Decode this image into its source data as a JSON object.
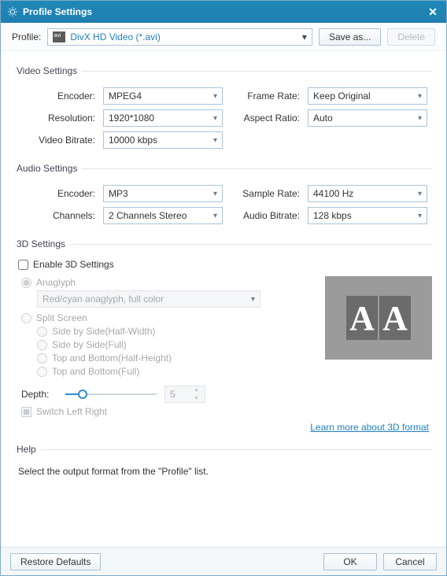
{
  "window": {
    "title": "Profile Settings"
  },
  "profile": {
    "label": "Profile:",
    "value": "DivX HD Video (*.avi)",
    "save_as": "Save as...",
    "delete": "Delete"
  },
  "video": {
    "legend": "Video Settings",
    "encoder_label": "Encoder:",
    "encoder": "MPEG4",
    "framerate_label": "Frame Rate:",
    "framerate": "Keep Original",
    "resolution_label": "Resolution:",
    "resolution": "1920*1080",
    "aspect_label": "Aspect Ratio:",
    "aspect": "Auto",
    "bitrate_label": "Video Bitrate:",
    "bitrate": "10000 kbps"
  },
  "audio": {
    "legend": "Audio Settings",
    "encoder_label": "Encoder:",
    "encoder": "MP3",
    "samplerate_label": "Sample Rate:",
    "samplerate": "44100 Hz",
    "channels_label": "Channels:",
    "channels": "2 Channels Stereo",
    "bitrate_label": "Audio Bitrate:",
    "bitrate": "128 kbps"
  },
  "threeD": {
    "legend": "3D Settings",
    "enable_label": "Enable 3D Settings",
    "anaglyph_label": "Anaglyph",
    "anaglyph_value": "Red/cyan anaglyph, full color",
    "split_label": "Split Screen",
    "opt_sxs_half": "Side by Side(Half-Width)",
    "opt_sxs_full": "Side by Side(Full)",
    "opt_tb_half": "Top and Bottom(Half-Height)",
    "opt_tb_full": "Top and Bottom(Full)",
    "depth_label": "Depth:",
    "depth_value": "5",
    "switch_label": "Switch Left Right",
    "learn_more": "Learn more about 3D format"
  },
  "help": {
    "legend": "Help",
    "text": "Select the output format from the \"Profile\" list."
  },
  "footer": {
    "restore": "Restore Defaults",
    "ok": "OK",
    "cancel": "Cancel"
  }
}
